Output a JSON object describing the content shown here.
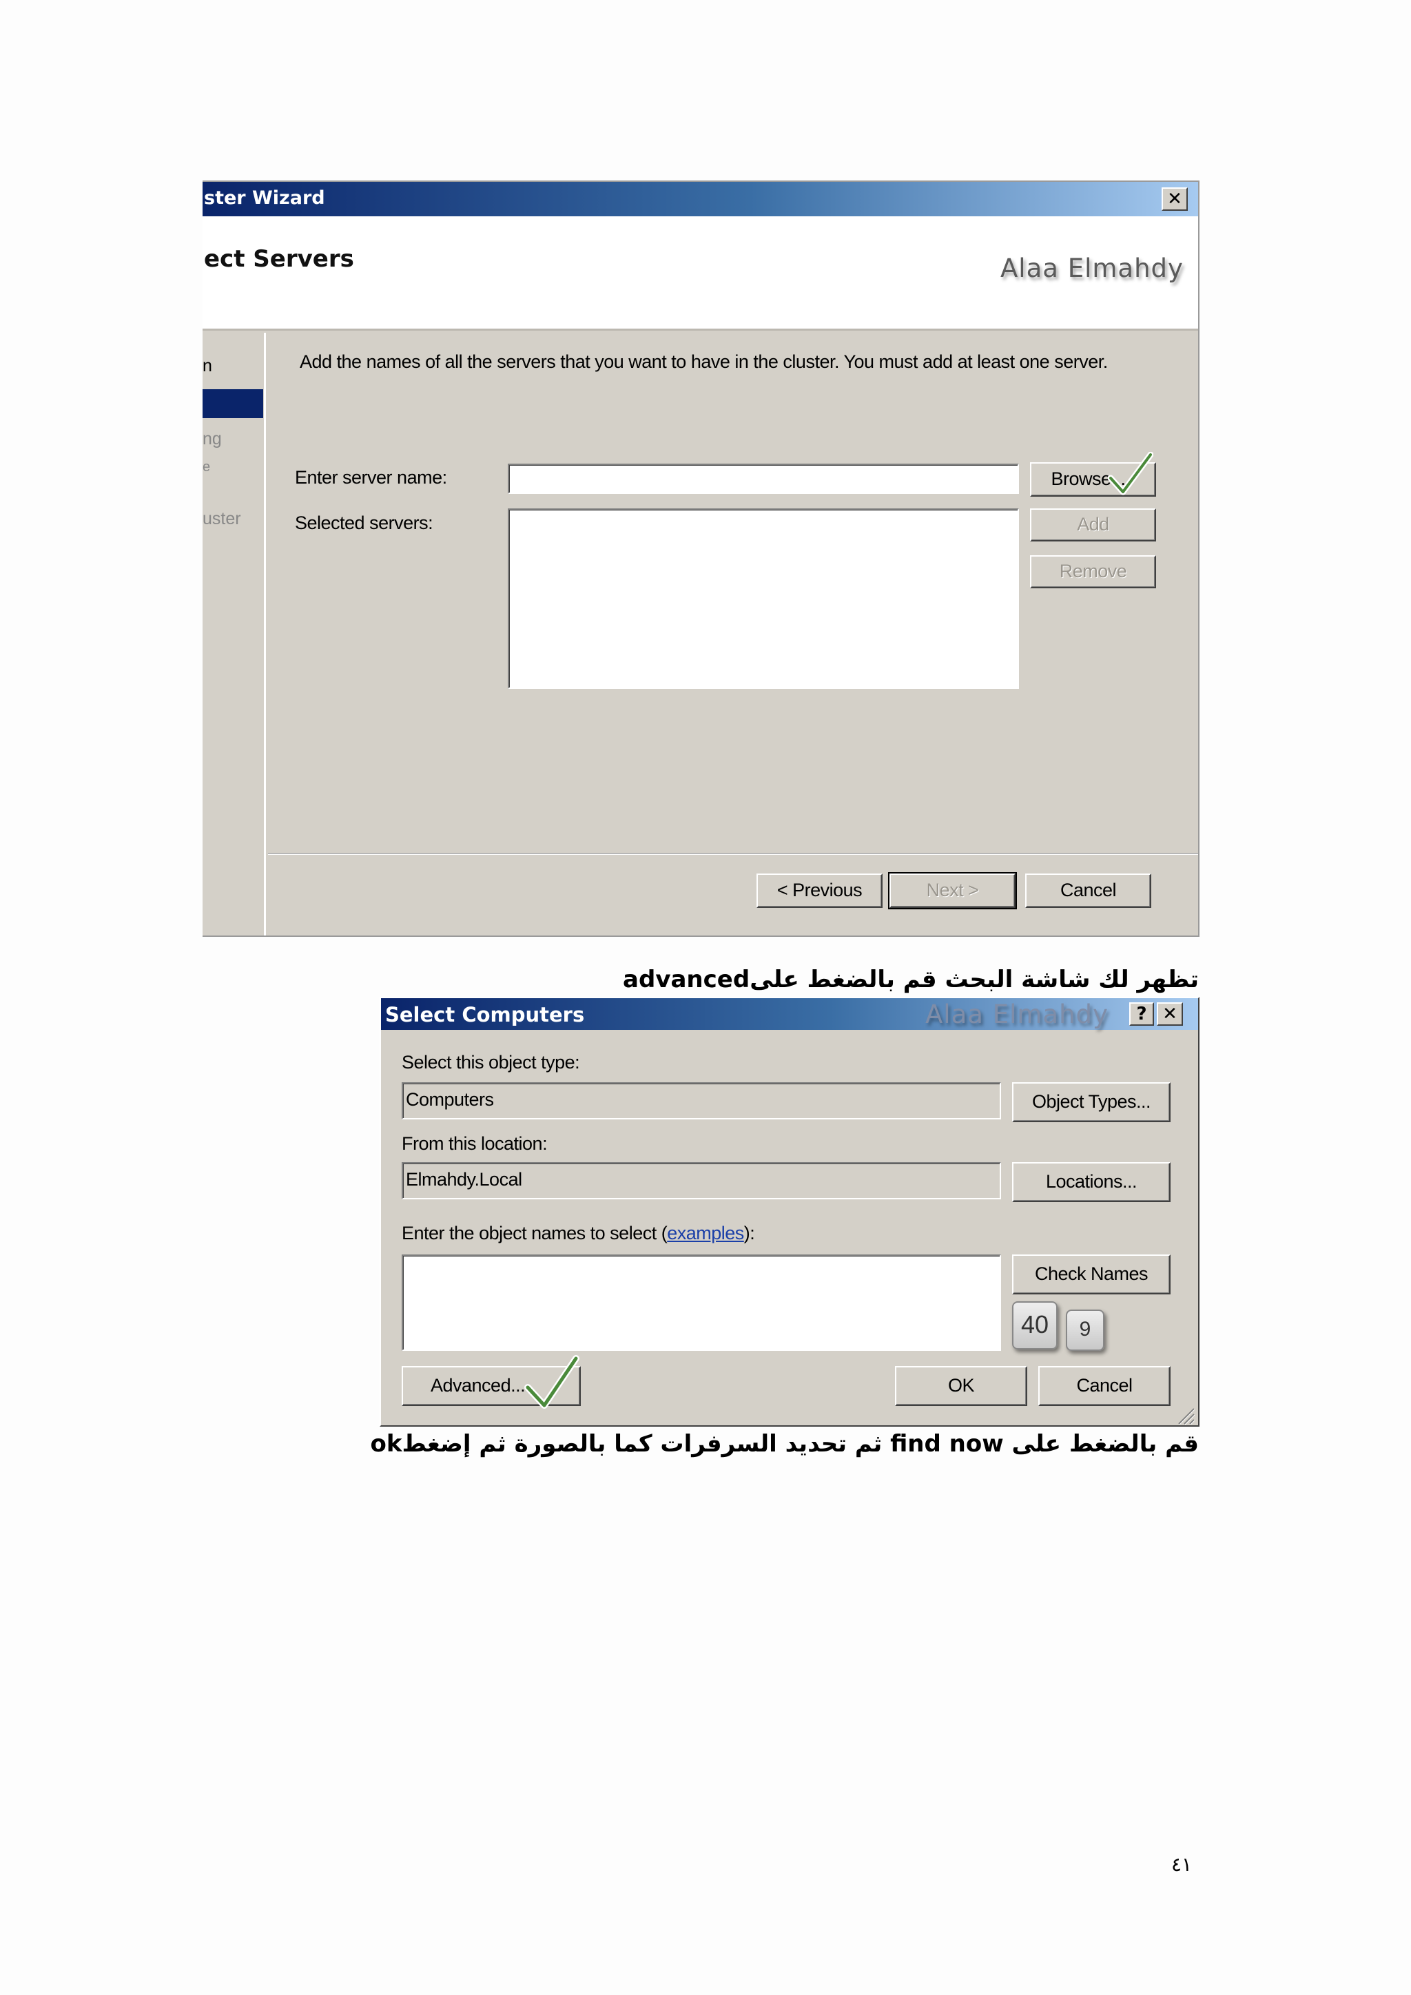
{
  "wizard": {
    "title": "ster Wizard",
    "heading": "ect Servers",
    "watermark": "Alaa Elmahdy",
    "nav_items": [
      "n",
      "ng",
      "e",
      "uster"
    ],
    "instruction": "Add the names of all the servers that you want to have in the cluster. You must add at least one server.",
    "server_name_label": "Enter server name:",
    "server_name_value": "",
    "selected_servers_label": "Selected servers:",
    "browse_label": "Browse...",
    "add_label": "Add",
    "remove_label": "Remove",
    "previous_label": "< Previous",
    "next_label": "Next >",
    "cancel_label": "Cancel",
    "close_glyph": "✕"
  },
  "caption1": "تظهر لك شاشة البحث قم بالضغط علىadvanced",
  "select_computers": {
    "title": "Select Computers",
    "watermark": "Alaa Elmahdy",
    "help_glyph": "?",
    "close_glyph": "✕",
    "object_type_label": "Select this object type:",
    "object_type_value": "Computers",
    "object_types_button": "Object Types...",
    "location_label": "From this location:",
    "location_value": "Elmahdy.Local",
    "locations_button": "Locations...",
    "names_label_prefix": "Enter the object names to select (",
    "names_label_link": "examples",
    "names_label_suffix": "):",
    "check_names_button": "Check Names",
    "advanced_button": "Advanced...",
    "ok_button": "OK",
    "cancel_button": "Cancel",
    "keycap_1": "40",
    "keycap_2": "9"
  },
  "caption2": "قم بالضغط على find now ثم تحديد السرفرات كما بالصورة ثم إضغطok",
  "page_number": "٤١",
  "colors": {
    "title_gradient_start": "#0a246a",
    "title_gradient_end": "#a6caf0",
    "dialog_face": "#d4d0c8",
    "checkmark": "#4a8a3a"
  }
}
